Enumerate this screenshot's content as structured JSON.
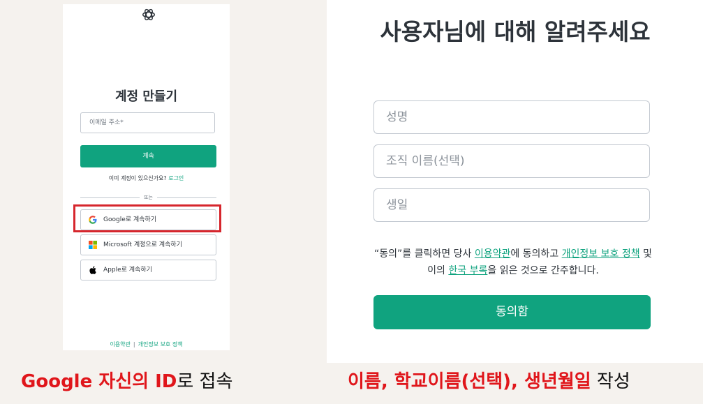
{
  "left_panel": {
    "title": "계정 만들기",
    "email_placeholder": "이메일 주소*",
    "continue_label": "계속",
    "have_account_text": "이미 계정이 있으신가요?",
    "login_link": "로그인",
    "or_text": "또는",
    "google_label": "Google로 계속하기",
    "microsoft_label": "Microsoft 계정으로 계속하기",
    "apple_label": "Apple로 계속하기",
    "terms_link": "이용약관",
    "separator": "|",
    "privacy_link": "개인정보 보호 정책",
    "highlight_color": "#d6262d"
  },
  "right_panel": {
    "title": "사용자님에 대해 알려주세요",
    "name_placeholder": "성명",
    "org_placeholder": "조직 이름(선택)",
    "birthday_placeholder": "생일",
    "consent": {
      "part1": "“동의”를 클릭하면 당사 ",
      "terms_link": "이용약관",
      "part2": "에 동의하고 ",
      "privacy_link": "개인정보 보호 정책",
      "part3": " 및 이의 ",
      "korea_link": "한국 부록",
      "part4": "을 읽은 것으로 간주합니다."
    },
    "agree_label": "동의함"
  },
  "captions": {
    "left_red": "Google 자신의 ID",
    "left_black": "로 접속",
    "right_red": "이름, 학교이름(선택), 생년월일",
    "right_black": " 작성"
  },
  "colors": {
    "accent": "#10a37f",
    "caption_red": "#e0161b",
    "background": "#f5f2ee"
  }
}
